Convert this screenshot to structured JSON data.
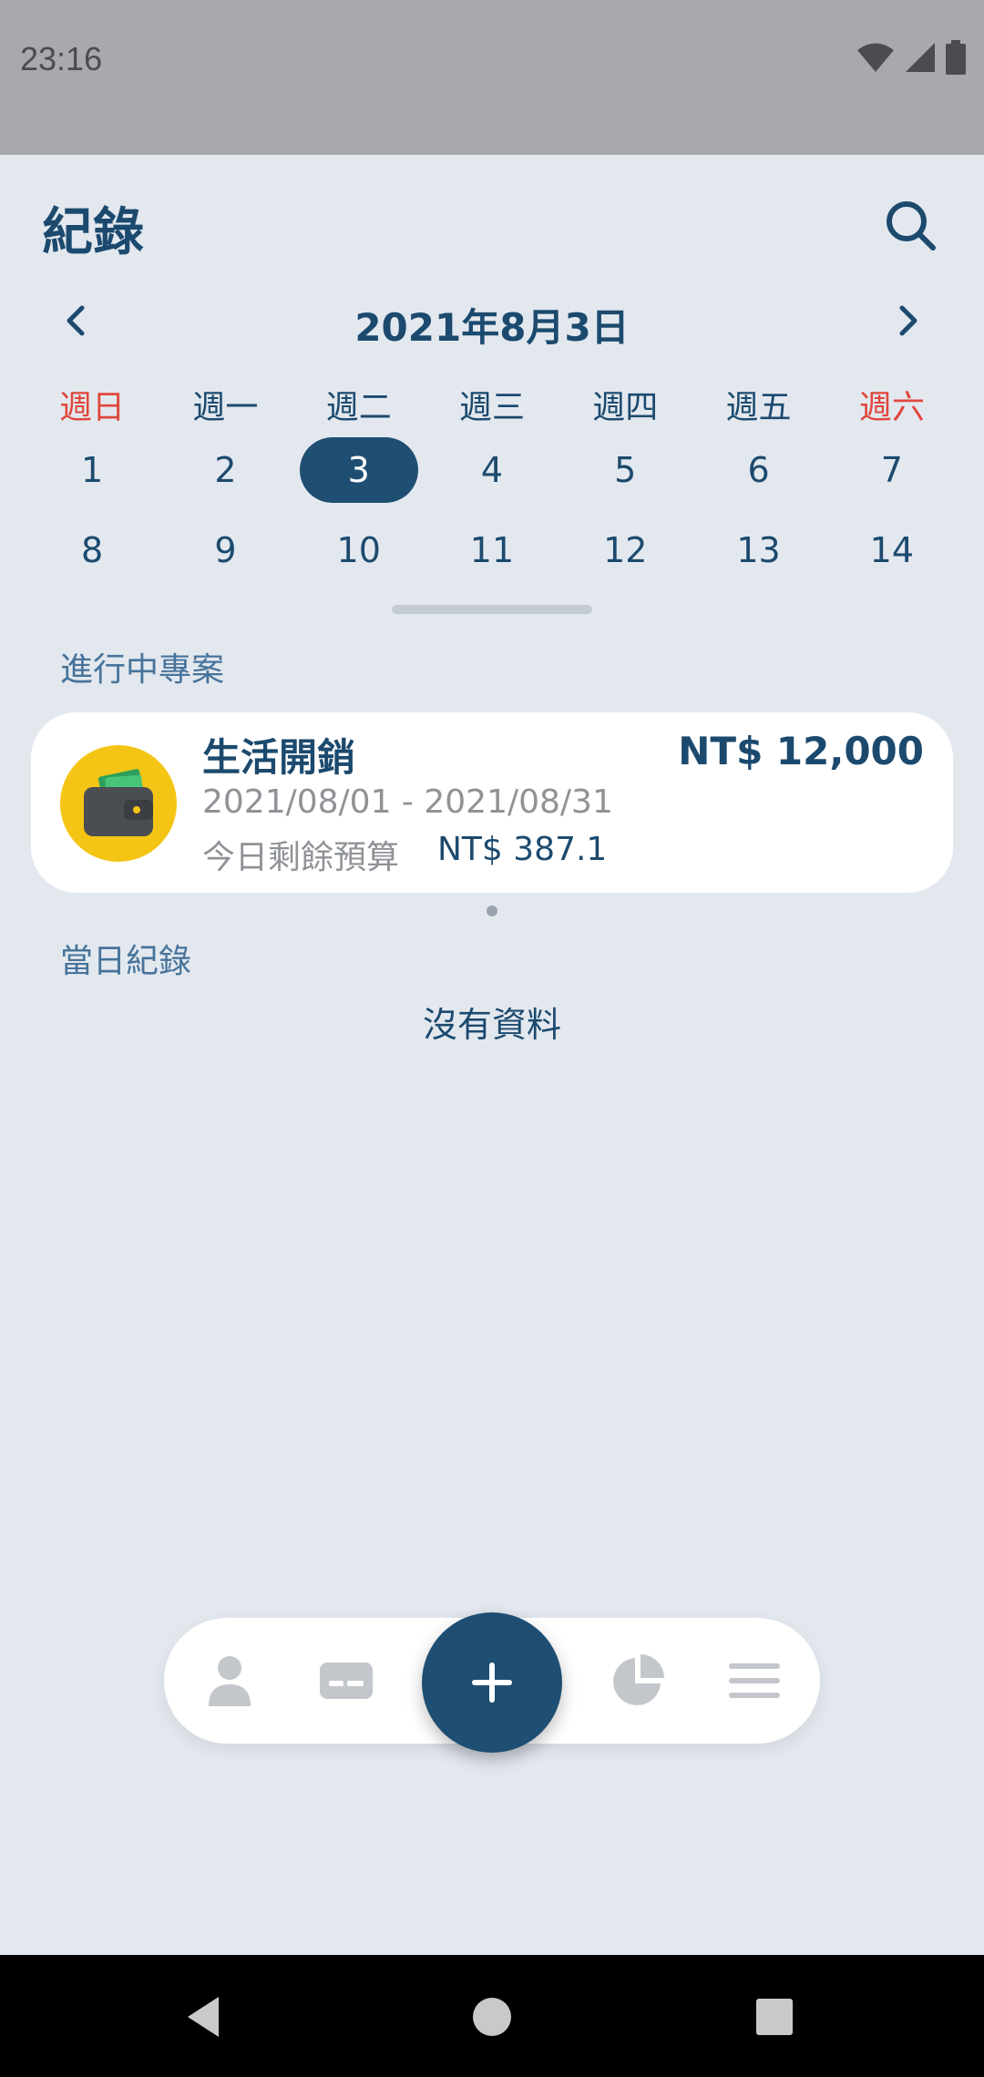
{
  "status_bar": {
    "time": "23:16"
  },
  "header": {
    "title": "紀錄"
  },
  "calendar": {
    "month_label": "2021年8月3日",
    "weekdays": [
      "週日",
      "週一",
      "週二",
      "週三",
      "週四",
      "週五",
      "週六"
    ],
    "weeks": [
      [
        "1",
        "2",
        "3",
        "4",
        "5",
        "6",
        "7"
      ],
      [
        "8",
        "9",
        "10",
        "11",
        "12",
        "13",
        "14"
      ]
    ],
    "selected_day": "3"
  },
  "projects": {
    "section_label": "進行中專案",
    "items": [
      {
        "name": "生活開銷",
        "amount": "NT$ 12,000",
        "dates": "2021/08/01 - 2021/08/31",
        "budget_label": "今日剩餘預算",
        "budget_value": "NT$ 387.1",
        "icon": "wallet-icon"
      }
    ]
  },
  "daily": {
    "section_label": "當日紀錄",
    "empty_text": "沒有資料"
  },
  "bottom_nav": {
    "items": [
      "person-icon",
      "card-icon",
      "add-icon",
      "pie-chart-icon",
      "menu-icon"
    ]
  },
  "colors": {
    "primary": "#1e4e72",
    "weekend": "#e0473c",
    "background": "#e3e8ef",
    "icon_yellow": "#f4c514"
  }
}
